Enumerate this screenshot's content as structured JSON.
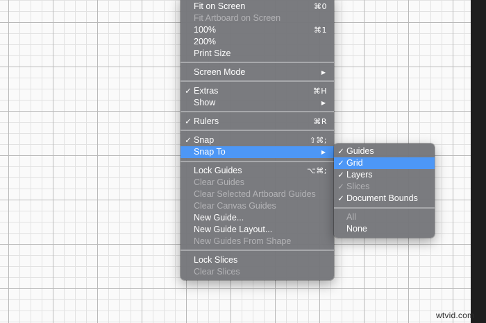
{
  "menu": {
    "items": [
      {
        "label": "Fit on Screen",
        "shortcut": "⌘0",
        "check": "",
        "disabled": false
      },
      {
        "label": "Fit Artboard on Screen",
        "shortcut": "",
        "check": "",
        "disabled": true
      },
      {
        "label": "100%",
        "shortcut": "⌘1",
        "check": "",
        "disabled": false
      },
      {
        "label": "200%",
        "shortcut": "",
        "check": "",
        "disabled": false
      },
      {
        "label": "Print Size",
        "shortcut": "",
        "check": "",
        "disabled": false
      },
      {
        "label": "Screen Mode",
        "shortcut": "",
        "arrow": "▶",
        "check": "",
        "disabled": false
      },
      {
        "label": "Extras",
        "shortcut": "⌘H",
        "check": "✓",
        "disabled": false
      },
      {
        "label": "Show",
        "shortcut": "",
        "arrow": "▶",
        "check": "",
        "disabled": false
      },
      {
        "label": "Rulers",
        "shortcut": "⌘R",
        "check": "✓",
        "disabled": false
      },
      {
        "label": "Snap",
        "shortcut": "⇧⌘;",
        "check": "✓",
        "disabled": false
      },
      {
        "label": "Snap To",
        "shortcut": "",
        "arrow": "▶",
        "check": "",
        "disabled": false,
        "highlighted": true
      },
      {
        "label": "Lock Guides",
        "shortcut": "⌥⌘;",
        "check": "",
        "disabled": false
      },
      {
        "label": "Clear Guides",
        "shortcut": "",
        "check": "",
        "disabled": true
      },
      {
        "label": "Clear Selected Artboard Guides",
        "shortcut": "",
        "check": "",
        "disabled": true
      },
      {
        "label": "Clear Canvas Guides",
        "shortcut": "",
        "check": "",
        "disabled": true
      },
      {
        "label": "New Guide...",
        "shortcut": "",
        "check": "",
        "disabled": false
      },
      {
        "label": "New Guide Layout...",
        "shortcut": "",
        "check": "",
        "disabled": false
      },
      {
        "label": "New Guides From Shape",
        "shortcut": "",
        "check": "",
        "disabled": true
      },
      {
        "label": "Lock Slices",
        "shortcut": "",
        "check": "",
        "disabled": false
      },
      {
        "label": "Clear Slices",
        "shortcut": "",
        "check": "",
        "disabled": true
      }
    ]
  },
  "submenu": {
    "items": [
      {
        "label": "Guides",
        "check": "✓",
        "disabled": false
      },
      {
        "label": "Grid",
        "check": "✓",
        "disabled": false,
        "highlighted": true
      },
      {
        "label": "Layers",
        "check": "✓",
        "disabled": false
      },
      {
        "label": "Slices",
        "check": "✓",
        "disabled": true
      },
      {
        "label": "Document Bounds",
        "check": "✓",
        "disabled": false
      },
      {
        "label": "All",
        "check": "",
        "disabled": true
      },
      {
        "label": "None",
        "check": "",
        "disabled": false
      }
    ]
  },
  "watermark": "wtvid.com",
  "colors": {
    "menu_bg": "#76777b",
    "highlight": "#4d97f6",
    "disabled_text": "#b3b3b6",
    "grid_minor": "#e2e2e2",
    "grid_major": "#b9b9b9"
  }
}
